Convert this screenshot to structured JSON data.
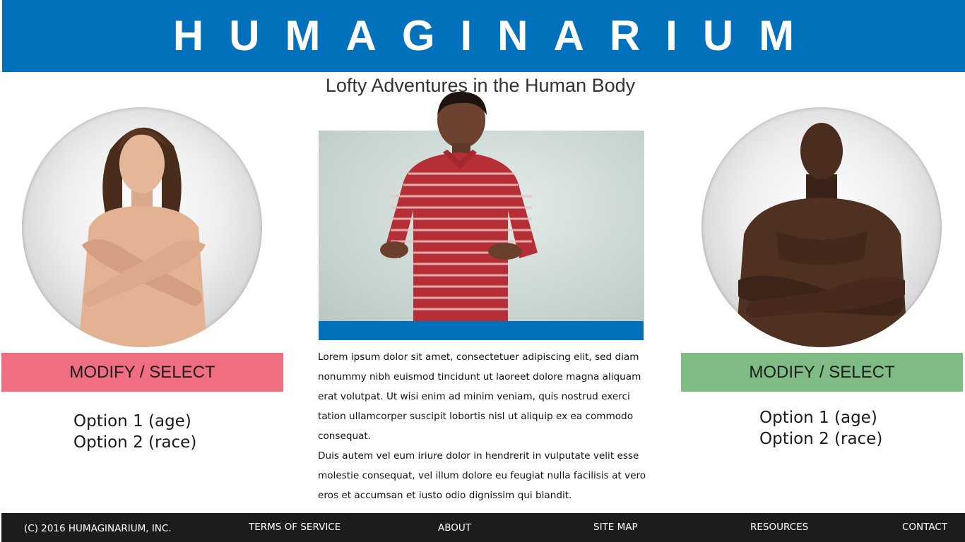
{
  "header": {
    "logo_text": "HUMAGINARIUM",
    "tagline": "Lofty Adventures in the Human Body",
    "bg_color": "#0271bb"
  },
  "left_panel": {
    "image": "female-model-portrait",
    "button_label": "MODIFY / SELECT",
    "button_color": "#f06e82",
    "options": [
      "Option 1 (age)",
      "Option 2 (race)"
    ]
  },
  "right_panel": {
    "image": "male-model-portrait",
    "button_label": "MODIFY / SELECT",
    "button_color": "#7fbc85",
    "options": [
      "Option 1 (age)",
      "Option 2 (race)"
    ]
  },
  "center": {
    "video": "presenter-video",
    "paragraphs": [
      "Lorem ipsum dolor sit amet, consectetuer adipiscing elit, sed diam nonummy nibh euismod tincidunt ut laoreet dolore magna aliquam erat volutpat.  Ut wisi enim ad minim veniam, quis nostrud exerci tation ullamcorper suscipit lobortis nisl ut aliquip ex ea commodo consequat.",
      "Duis autem vel eum iriure dolor in hendrerit in vulputate velit esse molestie consequat, vel illum dolore eu feugiat nulla facilisis at vero eros et accumsan et iusto odio dignissim qui blandit."
    ]
  },
  "footer": {
    "copyright": "(C) 2016 HUMAGINARIUM, INC.",
    "links": [
      "TERMS OF SERVICE",
      "ABOUT",
      "SITE MAP",
      "RESOURCES",
      "CONTACT"
    ],
    "bg_color": "#1c1c1c"
  }
}
